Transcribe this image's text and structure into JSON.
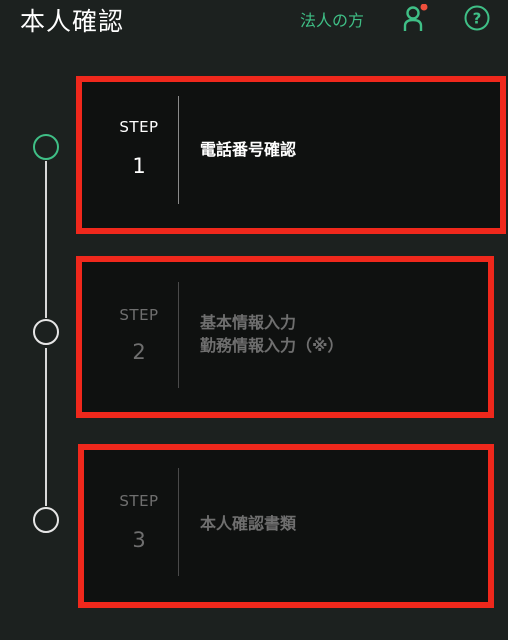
{
  "header": {
    "title": "本人確認",
    "corporate_link": "法人の方",
    "icons": {
      "user": "user-icon",
      "notification_dot_color": "#f0503c",
      "help": "help-icon"
    }
  },
  "steps": [
    {
      "label": "STEP",
      "number": "1",
      "title_lines": [
        "電話番号確認"
      ],
      "active": true
    },
    {
      "label": "STEP",
      "number": "2",
      "title_lines": [
        "基本情報入力",
        "勤務情報入力（※）"
      ],
      "active": false
    },
    {
      "label": "STEP",
      "number": "3",
      "title_lines": [
        "本人確認書類"
      ],
      "active": false
    }
  ],
  "colors": {
    "background": "#1c211f",
    "card": "#0f1110",
    "accent": "#3fbf86",
    "highlight_border": "#f0281c",
    "inactive_text": "#6f6f6f"
  }
}
